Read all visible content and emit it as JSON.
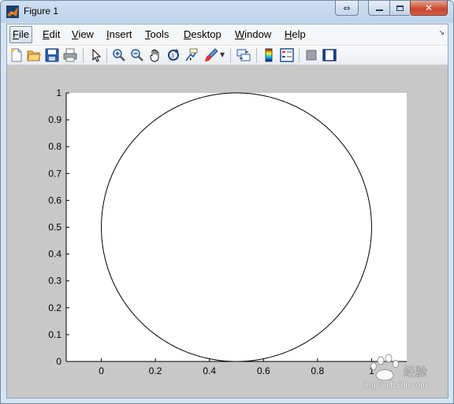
{
  "window": {
    "title": "Figure 1",
    "icon": "matlab-icon"
  },
  "system_buttons": [
    "restore-icon",
    "minimize-icon",
    "maximize-icon",
    "close-icon"
  ],
  "menu": [
    {
      "label": "File",
      "underline": "F"
    },
    {
      "label": "Edit",
      "underline": "E"
    },
    {
      "label": "View",
      "underline": "V"
    },
    {
      "label": "Insert",
      "underline": "I"
    },
    {
      "label": "Tools",
      "underline": "T"
    },
    {
      "label": "Desktop",
      "underline": "D"
    },
    {
      "label": "Window",
      "underline": "W"
    },
    {
      "label": "Help",
      "underline": "H"
    }
  ],
  "toolbar_icons": [
    "new-figure-icon",
    "open-file-icon",
    "save-icon",
    "print-icon",
    "edit-plot-icon",
    "zoom-in-icon",
    "zoom-out-icon",
    "pan-icon",
    "rotate-3d-icon",
    "data-cursor-icon",
    "brush-icon",
    "link-plot-icon",
    "insert-colorbar-icon",
    "insert-legend-icon",
    "hide-plot-tools-icon",
    "show-plot-tools-icon"
  ],
  "chart_data": {
    "type": "line",
    "title": "",
    "xlabel": "",
    "ylabel": "",
    "xlim": [
      -0.13,
      1.13
    ],
    "ylim": [
      0,
      1
    ],
    "xticks": [
      0,
      0.2,
      0.4,
      0.6,
      0.8,
      1
    ],
    "xtick_labels": [
      "0",
      "0.2",
      "0.4",
      "0.6",
      "0.8",
      "1"
    ],
    "yticks": [
      0,
      0.1,
      0.2,
      0.3,
      0.4,
      0.5,
      0.6,
      0.7,
      0.8,
      0.9,
      1
    ],
    "ytick_labels": [
      "0",
      "0.1",
      "0.2",
      "0.3",
      "0.4",
      "0.5",
      "0.6",
      "0.7",
      "0.8",
      "0.9",
      "1"
    ],
    "grid": false,
    "series": [
      {
        "shape": "circle",
        "center": [
          0.5,
          0.5
        ],
        "radius": 0.5,
        "color": "#000000"
      }
    ]
  },
  "watermark": {
    "text": "jingyan.baidu.com",
    "brand": "Bai du 经验"
  }
}
